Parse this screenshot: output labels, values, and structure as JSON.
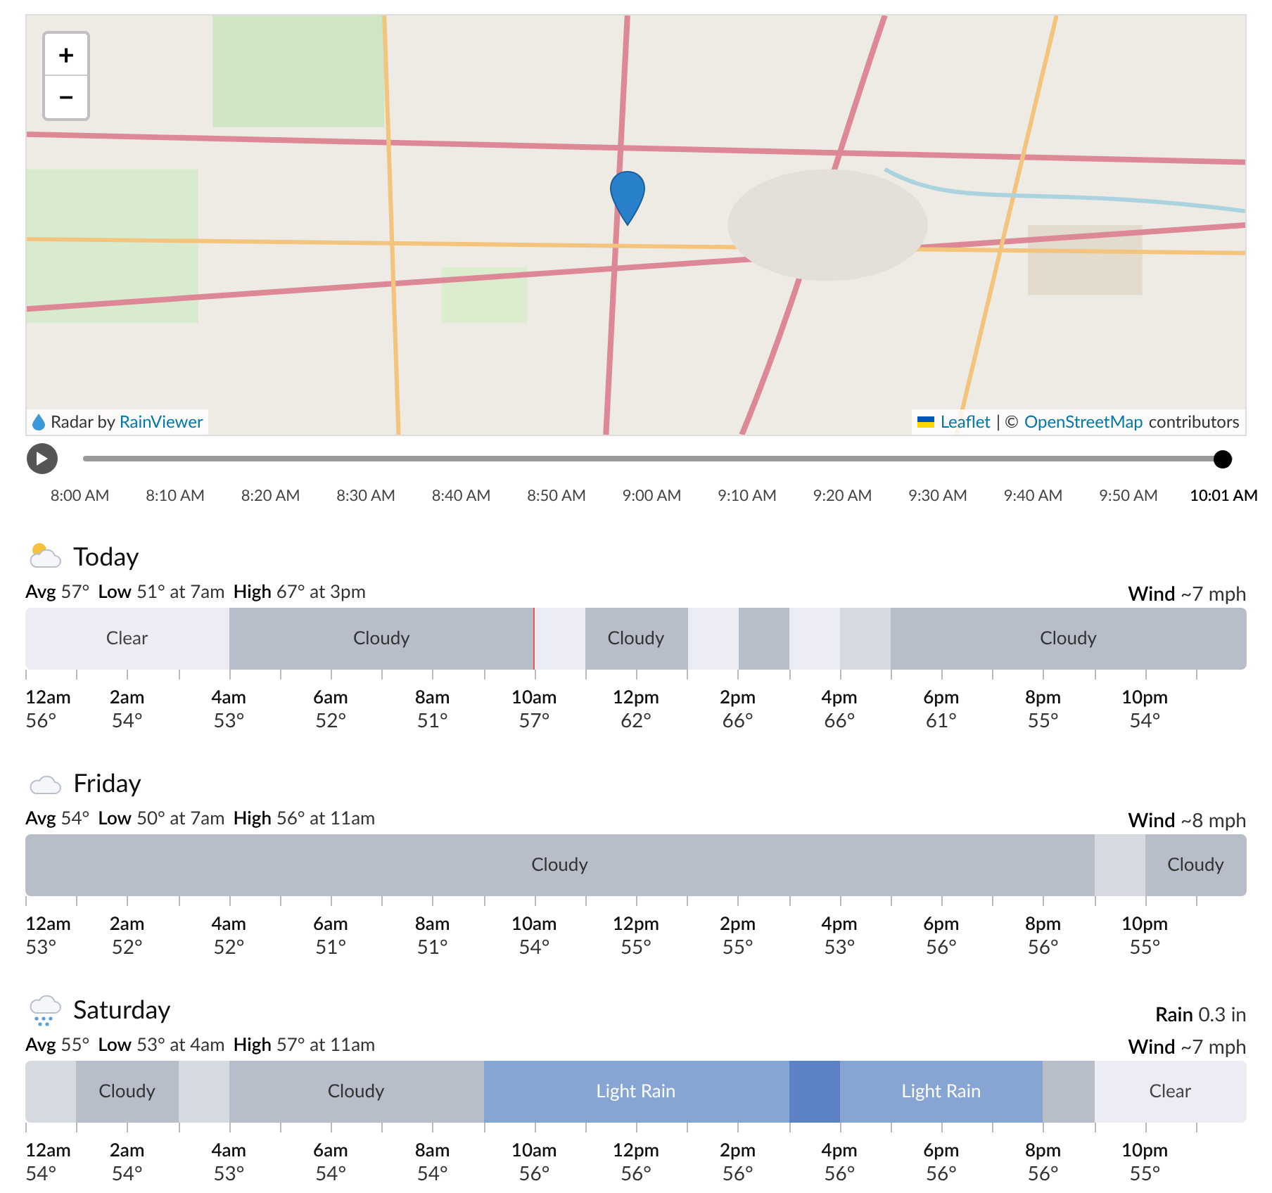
{
  "map": {
    "zoom_in": "+",
    "zoom_out": "−",
    "radar_credit": {
      "prefix": "Radar by",
      "link": "RainViewer"
    },
    "attribution": {
      "leaflet": "Leaflet",
      "separator": "| ©",
      "osm": "OpenStreetMap",
      "suffix": "contributors"
    }
  },
  "timeline": {
    "level": 1,
    "times": [
      {
        "label": "8:00 AM",
        "selected": false
      },
      {
        "label": "8:10 AM",
        "selected": false
      },
      {
        "label": "8:20 AM",
        "selected": false
      },
      {
        "label": "8:30 AM",
        "selected": false
      },
      {
        "label": "8:40 AM",
        "selected": false
      },
      {
        "label": "8:50 AM",
        "selected": false
      },
      {
        "label": "9:00 AM",
        "selected": false
      },
      {
        "label": "9:10 AM",
        "selected": false
      },
      {
        "label": "9:20 AM",
        "selected": false
      },
      {
        "label": "9:30 AM",
        "selected": false
      },
      {
        "label": "9:40 AM",
        "selected": false
      },
      {
        "label": "9:50 AM",
        "selected": false
      },
      {
        "label": "10:01 AM",
        "selected": true
      }
    ]
  },
  "days": [
    {
      "name": "Today",
      "kind": "partly-cloudy",
      "stats": [
        {
          "label": "Avg",
          "value": "57°"
        },
        {
          "label": "Low",
          "value": "51° at 7am"
        },
        {
          "label": "High",
          "value": "67° at 3pm"
        }
      ],
      "extras": [
        {
          "label": "Wind",
          "value": "~7 mph"
        }
      ],
      "conditions": [
        {
          "kind": "clear",
          "label": "Clear",
          "now": false
        },
        {
          "kind": "clear",
          "now": false
        },
        {
          "kind": "clear",
          "now": false
        },
        {
          "kind": "clear",
          "now": false
        },
        {
          "kind": "cloudy",
          "label": "Cloudy",
          "now": false
        },
        {
          "kind": "cloudy",
          "now": false
        },
        {
          "kind": "cloudy",
          "now": false
        },
        {
          "kind": "cloudy",
          "now": false
        },
        {
          "kind": "cloudy",
          "now": false
        },
        {
          "kind": "cloudy",
          "now": false
        },
        {
          "kind": "clear",
          "now": true
        },
        {
          "kind": "cloudy",
          "label": "Cloudy",
          "now": false
        },
        {
          "kind": "cloudy",
          "now": false
        },
        {
          "kind": "clear",
          "now": false
        },
        {
          "kind": "cloudy",
          "now": false
        },
        {
          "kind": "clear",
          "now": false
        },
        {
          "kind": "partly",
          "now": false
        },
        {
          "kind": "cloudy",
          "label": "Cloudy",
          "now": false
        },
        {
          "kind": "cloudy",
          "now": false
        },
        {
          "kind": "cloudy",
          "now": false
        },
        {
          "kind": "cloudy",
          "now": false
        },
        {
          "kind": "cloudy",
          "now": false
        },
        {
          "kind": "cloudy",
          "now": false
        },
        {
          "kind": "cloudy",
          "now": false
        }
      ],
      "hours": [
        {
          "time": "12am",
          "temp": "56°"
        },
        {
          "time": "2am",
          "temp": "54°"
        },
        {
          "time": "4am",
          "temp": "53°"
        },
        {
          "time": "6am",
          "temp": "52°"
        },
        {
          "time": "8am",
          "temp": "51°"
        },
        {
          "time": "10am",
          "temp": "57°"
        },
        {
          "time": "12pm",
          "temp": "62°"
        },
        {
          "time": "2pm",
          "temp": "66°"
        },
        {
          "time": "4pm",
          "temp": "66°"
        },
        {
          "time": "6pm",
          "temp": "61°"
        },
        {
          "time": "8pm",
          "temp": "55°"
        },
        {
          "time": "10pm",
          "temp": "54°"
        }
      ]
    },
    {
      "name": "Friday",
      "kind": "cloudy",
      "stats": [
        {
          "label": "Avg",
          "value": "54°"
        },
        {
          "label": "Low",
          "value": "50° at 7am"
        },
        {
          "label": "High",
          "value": "56° at 11am"
        }
      ],
      "extras": [
        {
          "label": "Wind",
          "value": "~8 mph"
        }
      ],
      "conditions": [
        {
          "kind": "cloudy",
          "label": "Cloudy",
          "now": false
        },
        {
          "kind": "cloudy",
          "now": false
        },
        {
          "kind": "cloudy",
          "now": false
        },
        {
          "kind": "cloudy",
          "now": false
        },
        {
          "kind": "cloudy",
          "now": false
        },
        {
          "kind": "cloudy",
          "now": false
        },
        {
          "kind": "cloudy",
          "now": false
        },
        {
          "kind": "cloudy",
          "now": false
        },
        {
          "kind": "cloudy",
          "now": false
        },
        {
          "kind": "cloudy",
          "now": false
        },
        {
          "kind": "cloudy",
          "now": false
        },
        {
          "kind": "cloudy",
          "now": false
        },
        {
          "kind": "cloudy",
          "now": false
        },
        {
          "kind": "cloudy",
          "now": false
        },
        {
          "kind": "cloudy",
          "now": false
        },
        {
          "kind": "cloudy",
          "now": false
        },
        {
          "kind": "cloudy",
          "now": false
        },
        {
          "kind": "cloudy",
          "now": false
        },
        {
          "kind": "cloudy",
          "now": false
        },
        {
          "kind": "cloudy",
          "now": false
        },
        {
          "kind": "cloudy",
          "now": false
        },
        {
          "kind": "partly",
          "now": false
        },
        {
          "kind": "cloudy",
          "label": "Cloudy",
          "now": false
        },
        {
          "kind": "cloudy",
          "now": false
        }
      ],
      "hours": [
        {
          "time": "12am",
          "temp": "53°"
        },
        {
          "time": "2am",
          "temp": "52°"
        },
        {
          "time": "4am",
          "temp": "52°"
        },
        {
          "time": "6am",
          "temp": "51°"
        },
        {
          "time": "8am",
          "temp": "51°"
        },
        {
          "time": "10am",
          "temp": "54°"
        },
        {
          "time": "12pm",
          "temp": "55°"
        },
        {
          "time": "2pm",
          "temp": "55°"
        },
        {
          "time": "4pm",
          "temp": "53°"
        },
        {
          "time": "6pm",
          "temp": "56°"
        },
        {
          "time": "8pm",
          "temp": "56°"
        },
        {
          "time": "10pm",
          "temp": "55°"
        }
      ]
    },
    {
      "name": "Saturday",
      "kind": "rain",
      "stats": [
        {
          "label": "Avg",
          "value": "55°"
        },
        {
          "label": "Low",
          "value": "53° at 4am"
        },
        {
          "label": "High",
          "value": "57° at 11am"
        }
      ],
      "extras": [
        {
          "label": "Rain",
          "value": "0.3 in"
        },
        {
          "label": "Wind",
          "value": "~7 mph"
        }
      ],
      "conditions": [
        {
          "kind": "partly",
          "now": false
        },
        {
          "kind": "cloudy",
          "label": "Cloudy",
          "now": false
        },
        {
          "kind": "cloudy",
          "now": false
        },
        {
          "kind": "partly",
          "now": false
        },
        {
          "kind": "cloudy",
          "label": "Cloudy",
          "now": false
        },
        {
          "kind": "cloudy",
          "now": false
        },
        {
          "kind": "cloudy",
          "now": false
        },
        {
          "kind": "cloudy",
          "now": false
        },
        {
          "kind": "cloudy",
          "now": false
        },
        {
          "kind": "rain",
          "label": "Light Rain",
          "now": false
        },
        {
          "kind": "rain",
          "now": false
        },
        {
          "kind": "rain",
          "now": false
        },
        {
          "kind": "rain",
          "now": false
        },
        {
          "kind": "rain",
          "now": false
        },
        {
          "kind": "rain",
          "now": false
        },
        {
          "kind": "heavy-rain",
          "now": false
        },
        {
          "kind": "rain",
          "label": "Light Rain",
          "now": false
        },
        {
          "kind": "rain",
          "now": false
        },
        {
          "kind": "rain",
          "now": false
        },
        {
          "kind": "rain",
          "now": false
        },
        {
          "kind": "cloudy",
          "now": false
        },
        {
          "kind": "clear",
          "label": "Clear",
          "now": false
        },
        {
          "kind": "clear",
          "now": false
        },
        {
          "kind": "clear",
          "now": false
        }
      ],
      "hours": [
        {
          "time": "12am",
          "temp": "54°"
        },
        {
          "time": "2am",
          "temp": "54°"
        },
        {
          "time": "4am",
          "temp": "53°"
        },
        {
          "time": "6am",
          "temp": "54°"
        },
        {
          "time": "8am",
          "temp": "54°"
        },
        {
          "time": "10am",
          "temp": "56°"
        },
        {
          "time": "12pm",
          "temp": "56°"
        },
        {
          "time": "2pm",
          "temp": "56°"
        },
        {
          "time": "4pm",
          "temp": "56°"
        },
        {
          "time": "6pm",
          "temp": "56°"
        },
        {
          "time": "8pm",
          "temp": "56°"
        },
        {
          "time": "10pm",
          "temp": "55°"
        }
      ]
    }
  ]
}
